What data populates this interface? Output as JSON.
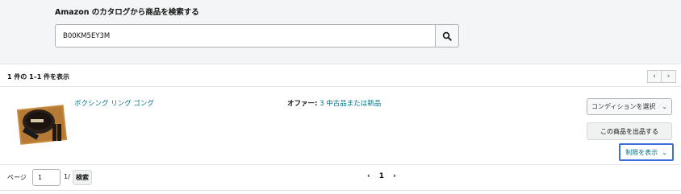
{
  "search": {
    "title": "Amazon のカタログから商品を検索する",
    "query": "B00KM5EY3M"
  },
  "results": {
    "count_text": "1 件の 1–1 件を表示",
    "prev_icon": "chevron-left-icon",
    "next_icon": "chevron-right-icon",
    "items": [
      {
        "title": "ボクシング リング ゴング",
        "offers_label": "オファー:",
        "offers_link": "3 中古品または新品",
        "condition_select": "コンディションを選択",
        "list_button": "この商品を出品する",
        "restrictions_button": "制限を表示"
      }
    ]
  },
  "pagination": {
    "page_label": "ページ",
    "page_value": "1",
    "total_text": "1/",
    "go_label": "検索",
    "current_page": "1"
  },
  "colors": {
    "link": "#007185",
    "focus_border": "#3b6fdc",
    "top_background": "#f3f5f6"
  }
}
